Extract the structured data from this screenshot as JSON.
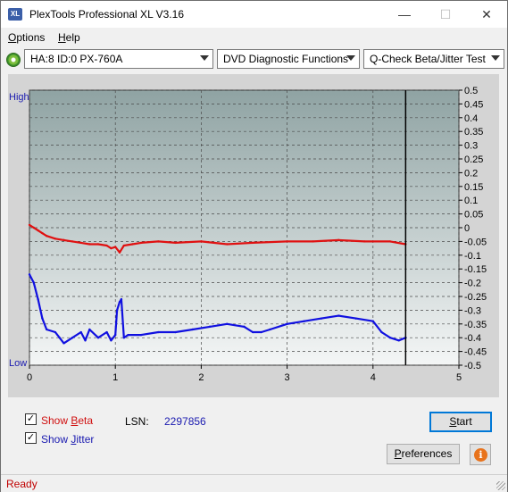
{
  "window": {
    "title": "PlexTools Professional XL V3.16",
    "icon_label": "XL",
    "minimize_glyph": "—",
    "maximize_glyph": "☐",
    "close_glyph": "✕"
  },
  "menu": {
    "options": {
      "first": "O",
      "rest": "ptions"
    },
    "help": {
      "first": "H",
      "rest": "elp"
    }
  },
  "toolbar": {
    "drive": "HA:8 ID:0  PX-760A",
    "function": "DVD Diagnostic Functions",
    "test": "Q-Check Beta/Jitter Test"
  },
  "chart_data": {
    "type": "line",
    "high_label": "High",
    "low_label": "Low",
    "xlim": [
      0,
      5
    ],
    "x_ticks": [
      "0",
      "1",
      "2",
      "3",
      "4",
      "5"
    ],
    "ylim": [
      -0.5,
      0.5
    ],
    "y_ticks": [
      "0.5",
      "0.45",
      "0.4",
      "0.35",
      "0.3",
      "0.25",
      "0.2",
      "0.15",
      "0.1",
      "0.05",
      "0",
      "-0.05",
      "-0.1",
      "-0.15",
      "-0.2",
      "-0.25",
      "-0.3",
      "-0.35",
      "-0.4",
      "-0.45",
      "-0.5"
    ],
    "end_marker_x": 4.38,
    "grid": true,
    "series": [
      {
        "name": "Beta",
        "color": "#e01010",
        "x": [
          0,
          0.05,
          0.1,
          0.15,
          0.2,
          0.3,
          0.4,
          0.5,
          0.6,
          0.7,
          0.8,
          0.9,
          0.95,
          1.0,
          1.05,
          1.1,
          1.2,
          1.3,
          1.5,
          1.7,
          2.0,
          2.3,
          2.6,
          3.0,
          3.3,
          3.6,
          3.9,
          4.2,
          4.38
        ],
        "y": [
          0.01,
          0.0,
          -0.01,
          -0.02,
          -0.03,
          -0.04,
          -0.045,
          -0.05,
          -0.055,
          -0.06,
          -0.06,
          -0.065,
          -0.075,
          -0.07,
          -0.09,
          -0.065,
          -0.06,
          -0.055,
          -0.05,
          -0.055,
          -0.05,
          -0.06,
          -0.055,
          -0.05,
          -0.05,
          -0.045,
          -0.05,
          -0.05,
          -0.06
        ]
      },
      {
        "name": "Jitter",
        "color": "#1010e0",
        "x": [
          0,
          0.05,
          0.1,
          0.15,
          0.2,
          0.3,
          0.35,
          0.4,
          0.5,
          0.6,
          0.65,
          0.7,
          0.8,
          0.9,
          0.95,
          1.0,
          1.02,
          1.05,
          1.07,
          1.1,
          1.15,
          1.3,
          1.5,
          1.7,
          1.9,
          2.1,
          2.3,
          2.5,
          2.6,
          2.7,
          2.8,
          3.0,
          3.2,
          3.4,
          3.6,
          3.8,
          4.0,
          4.1,
          4.2,
          4.3,
          4.38
        ],
        "y": [
          -0.17,
          -0.2,
          -0.26,
          -0.33,
          -0.37,
          -0.38,
          -0.4,
          -0.42,
          -0.4,
          -0.38,
          -0.41,
          -0.37,
          -0.4,
          -0.38,
          -0.41,
          -0.39,
          -0.3,
          -0.27,
          -0.26,
          -0.4,
          -0.39,
          -0.39,
          -0.38,
          -0.38,
          -0.37,
          -0.36,
          -0.35,
          -0.36,
          -0.38,
          -0.38,
          -0.37,
          -0.35,
          -0.34,
          -0.33,
          -0.32,
          -0.33,
          -0.34,
          -0.38,
          -0.4,
          -0.41,
          -0.4
        ]
      }
    ]
  },
  "bottom": {
    "show_beta": {
      "first": "Show ",
      "key": "B",
      "rest": "eta",
      "checked": true,
      "color": "#d01010"
    },
    "show_jitter": {
      "first": "Show ",
      "key": "J",
      "rest": "itter",
      "checked": true,
      "color": "#1a1ab0"
    },
    "check_glyph": "✓",
    "lsn_label": "LSN:",
    "lsn_value": "2297856",
    "start_button": {
      "key": "S",
      "rest": "tart"
    },
    "preferences_button": {
      "key": "P",
      "rest": "references"
    },
    "info_glyph": "i"
  },
  "status": {
    "text": "Ready"
  }
}
